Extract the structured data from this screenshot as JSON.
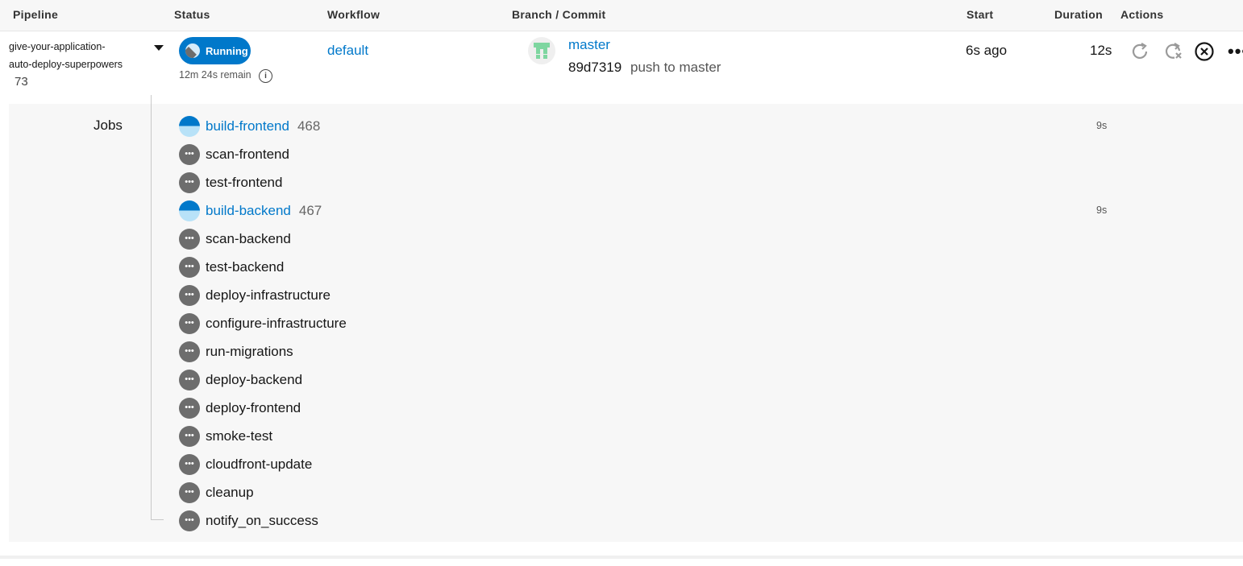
{
  "header": {
    "pipeline": "Pipeline",
    "status": "Status",
    "workflow": "Workflow",
    "branch_commit": "Branch / Commit",
    "start": "Start",
    "duration": "Duration",
    "actions": "Actions"
  },
  "pipeline": {
    "name_line1": "give-your-application-",
    "name_line2": "auto-deploy-superpowers",
    "number": "73",
    "status_label": "Running",
    "remaining": "12m 24s remain",
    "workflow": "default",
    "branch": "master",
    "commit_hash": "89d7319",
    "commit_message": "push to master",
    "start": "6s ago",
    "duration": "12s"
  },
  "colors": {
    "accent": "#0078ca",
    "running_light": "#b8e2f8",
    "pending": "#6d6d6d"
  },
  "jobs_label": "Jobs",
  "jobs": [
    {
      "name": "build-frontend",
      "number": "468",
      "duration": "9s",
      "status": "running"
    },
    {
      "name": "scan-frontend",
      "status": "pending"
    },
    {
      "name": "test-frontend",
      "status": "pending"
    },
    {
      "name": "build-backend",
      "number": "467",
      "duration": "9s",
      "status": "running"
    },
    {
      "name": "scan-backend",
      "status": "pending"
    },
    {
      "name": "test-backend",
      "status": "pending"
    },
    {
      "name": "deploy-infrastructure",
      "status": "pending"
    },
    {
      "name": "configure-infrastructure",
      "status": "pending"
    },
    {
      "name": "run-migrations",
      "status": "pending"
    },
    {
      "name": "deploy-backend",
      "status": "pending"
    },
    {
      "name": "deploy-frontend",
      "status": "pending"
    },
    {
      "name": "smoke-test",
      "status": "pending"
    },
    {
      "name": "cloudfront-update",
      "status": "pending"
    },
    {
      "name": "cleanup",
      "status": "pending"
    },
    {
      "name": "notify_on_success",
      "status": "pending"
    }
  ],
  "icons": {
    "rerun": "rerun-icon",
    "rerun_failed": "rerun-failed-icon",
    "cancel": "cancel-icon",
    "more": "more-icon",
    "info": "info-icon",
    "expand": "caret-down-icon"
  }
}
